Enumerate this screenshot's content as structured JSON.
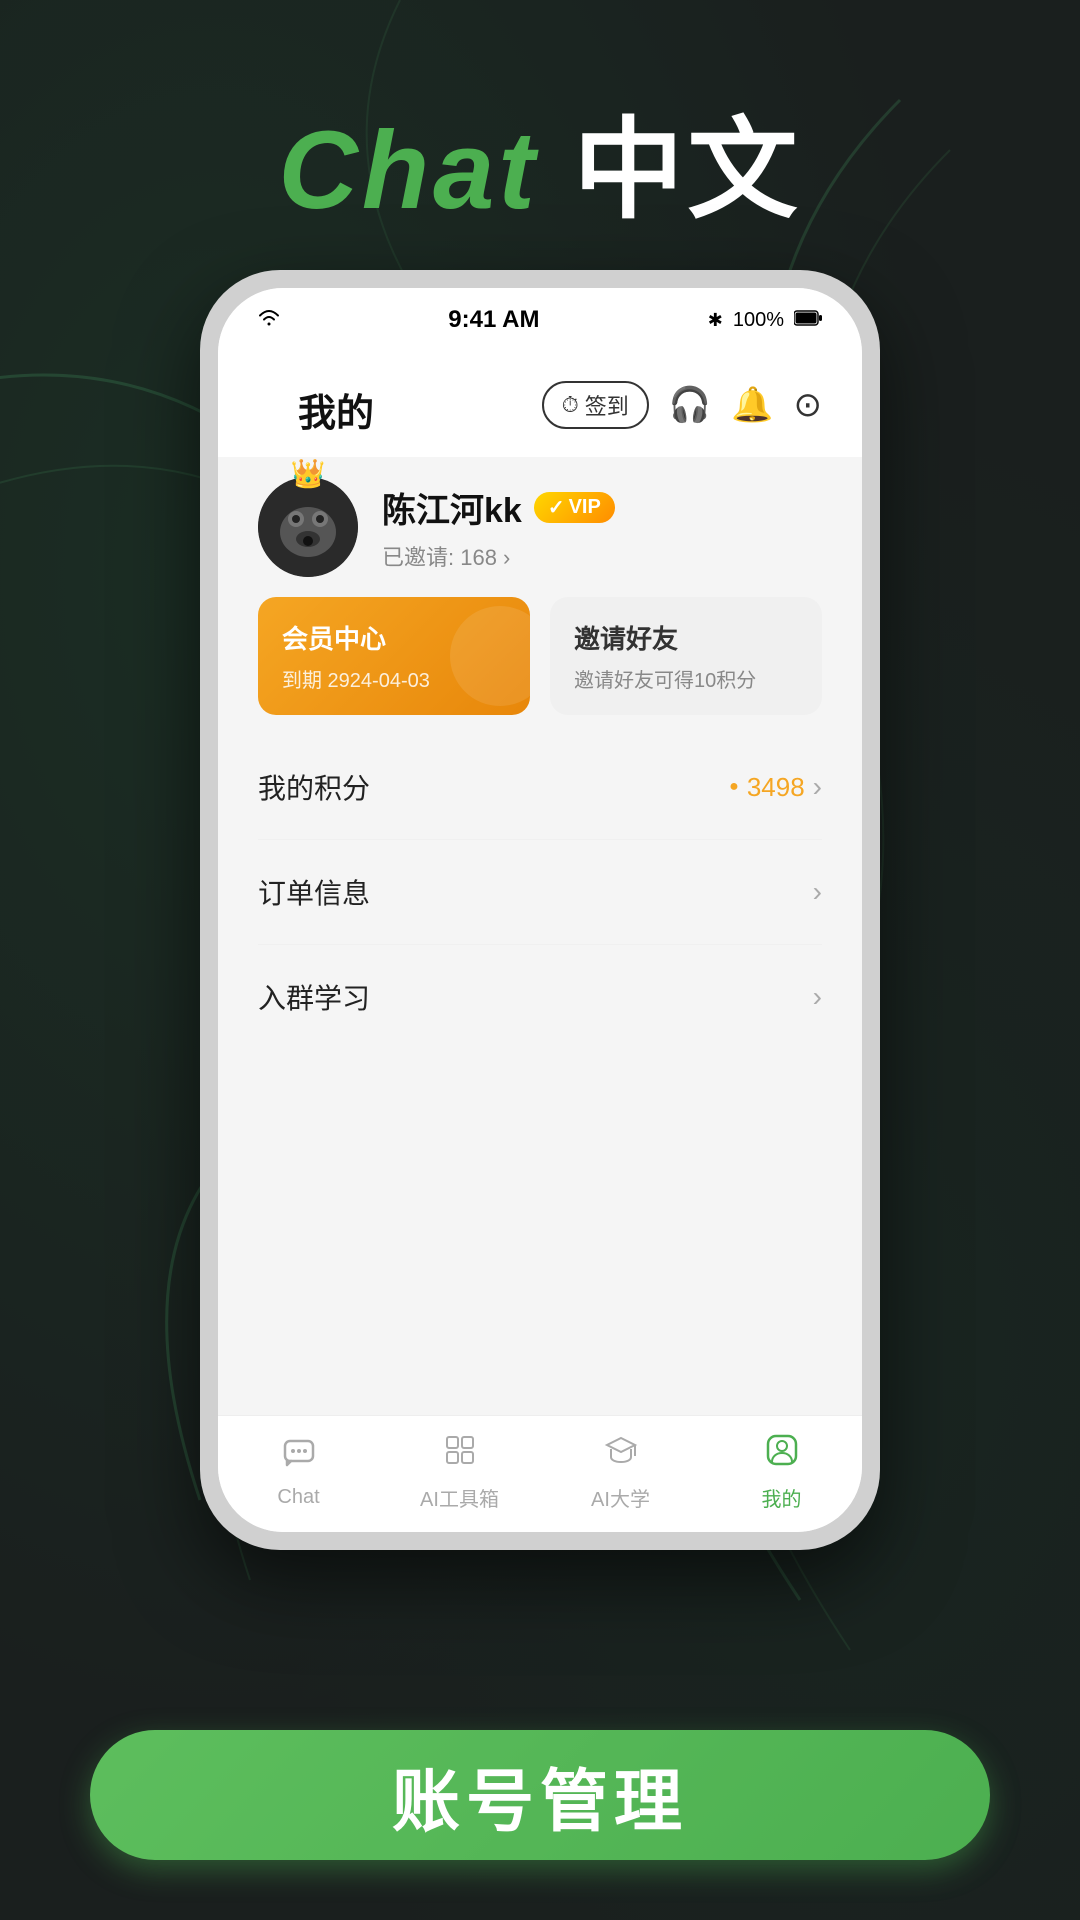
{
  "page": {
    "title_green": "Chat",
    "title_white": "中文"
  },
  "statusBar": {
    "wifi": "wifi",
    "time": "9:41 AM",
    "bluetooth": "bluetooth",
    "battery": "100%"
  },
  "appNav": {
    "title": "我的",
    "signBtn": "签到",
    "icons": [
      "headphones",
      "bell",
      "camera"
    ]
  },
  "profile": {
    "name": "陈江河kk",
    "vip_label": "VIP",
    "invite_text": "已邀请: 168 ›"
  },
  "cards": {
    "member": {
      "title": "会员中心",
      "subtitle": "到期 2924-04-03"
    },
    "invite": {
      "title": "邀请好友",
      "subtitle": "邀请好友可得10积分"
    }
  },
  "menuItems": [
    {
      "label": "我的积分",
      "rightText": "3498",
      "rightIcon": "coin",
      "showChevron": true
    },
    {
      "label": "订单信息",
      "rightText": "",
      "rightIcon": "",
      "showChevron": true
    },
    {
      "label": "入群学习",
      "rightText": "",
      "rightIcon": "",
      "showChevron": true
    }
  ],
  "bottomNav": [
    {
      "label": "Chat",
      "active": false,
      "icon": "chat"
    },
    {
      "label": "AI工具箱",
      "active": false,
      "icon": "toolbox"
    },
    {
      "label": "AI大学",
      "active": false,
      "icon": "university"
    },
    {
      "label": "我的",
      "active": true,
      "icon": "profile"
    }
  ],
  "actionButton": {
    "label": "账号管理"
  }
}
